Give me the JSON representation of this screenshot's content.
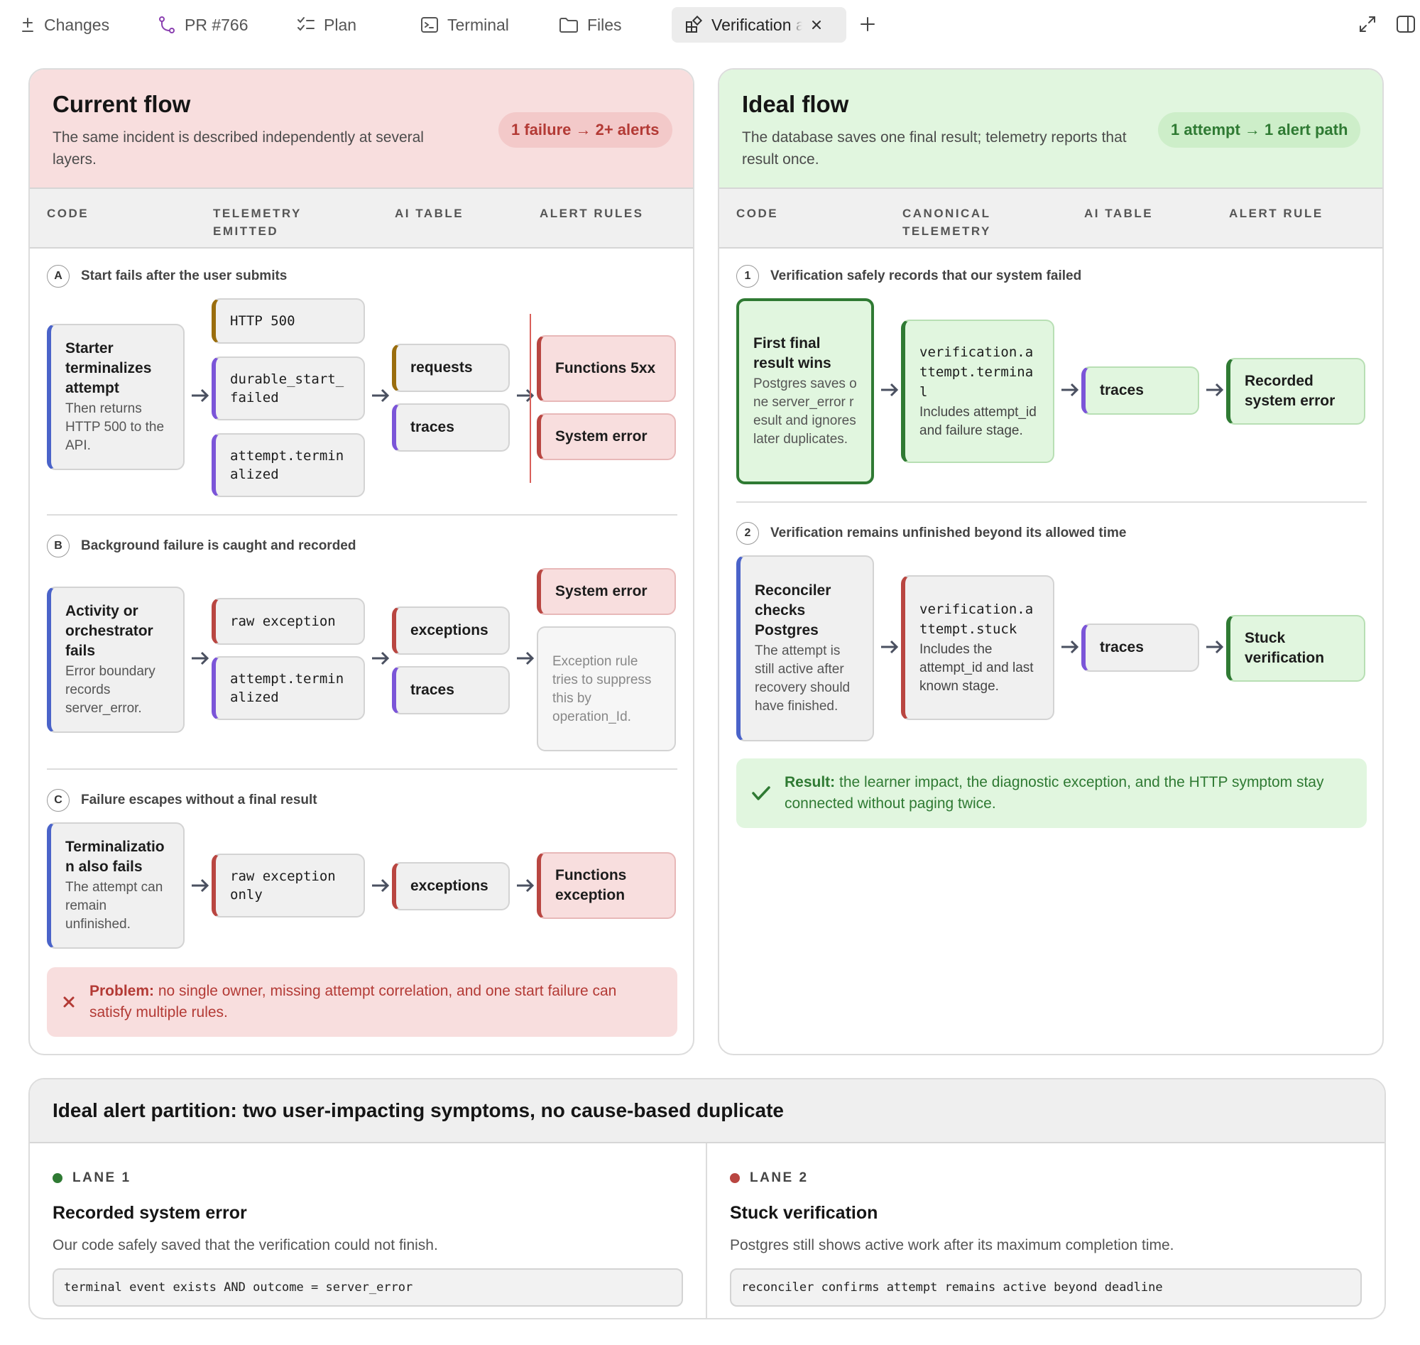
{
  "tabs": {
    "changes": "Changes",
    "pr": "PR #766",
    "plan": "Plan",
    "terminal": "Terminal",
    "files": "Files",
    "active": "Verification al"
  },
  "current": {
    "title": "Current flow",
    "subtitle": "The same incident is described independently at several layers.",
    "badge": "1 failure → 2+ alerts",
    "cols": [
      "CODE",
      "TELEMETRY EMITTED",
      "AI TABLE",
      "ALERT RULES"
    ],
    "a": {
      "letter": "A",
      "heading": "Start fails after the user submits",
      "code_title": "Starter terminalizes attempt",
      "code_sub": "Then returns HTTP 500 to the API.",
      "tel": [
        "HTTP 500",
        "durable_start_failed",
        "attempt.terminalized"
      ],
      "ai": [
        "requests",
        "traces"
      ],
      "alerts": [
        "Functions 5xx",
        "System error"
      ]
    },
    "b": {
      "letter": "B",
      "heading": "Background failure is caught and recorded",
      "code_title": "Activity or orchestrator fails",
      "code_sub": "Error boundary records server_error.",
      "tel": [
        "raw exception",
        "attempt.terminalized"
      ],
      "ai": [
        "exceptions",
        "traces"
      ],
      "alerts": [
        "System error",
        "Exception rule tries to suppress this by operation_Id."
      ]
    },
    "c": {
      "letter": "C",
      "heading": "Failure escapes without a final result",
      "code_title": "Terminalization also fails",
      "code_sub": "The attempt can remain unfinished.",
      "tel": "raw exception only",
      "ai": "exceptions",
      "alert": "Functions exception"
    },
    "problem_label": "Problem:",
    "problem_text": " no single owner, missing attempt correlation, and one start failure can satisfy multiple rules."
  },
  "ideal": {
    "title": "Ideal flow",
    "subtitle": "The database saves one final result; telemetry reports that result once.",
    "badge": "1 attempt → 1 alert path",
    "cols": [
      "CODE",
      "CANONICAL TELEMETRY",
      "AI TABLE",
      "ALERT RULE"
    ],
    "one": {
      "num": "1",
      "heading": "Verification safely records that our system failed",
      "code_title": "First final result wins",
      "code_sub": "Postgres saves one server_error result and ignores later duplicates.",
      "tel_code": "verification.attempt.terminal",
      "tel_sub": "Includes attempt_id and failure stage.",
      "ai": "traces",
      "alert": "Recorded system error"
    },
    "two": {
      "num": "2",
      "heading": "Verification remains unfinished beyond its allowed time",
      "code_title": "Reconciler checks Postgres",
      "code_sub": "The attempt is still active after recovery should have finished.",
      "tel_code": "verification.attempt.stuck",
      "tel_sub": "Includes the attempt_id and last known stage.",
      "ai": "traces",
      "alert": "Stuck verification"
    },
    "result_label": "Result:",
    "result_text": " the learner impact, the diagnostic exception, and the HTTP symptom stay connected without paging twice."
  },
  "partition": {
    "title": "Ideal alert partition: two user-impacting symptoms, no cause-based duplicate",
    "lane1": {
      "label": "LANE 1",
      "title": "Recorded system error",
      "desc": "Our code safely saved that the verification could not finish.",
      "code": "terminal event exists AND outcome = server_error"
    },
    "lane2": {
      "label": "LANE 2",
      "title": "Stuck verification",
      "desc": "Postgres still shows active work after its maximum completion time.",
      "code": "reconciler confirms attempt remains active beyond deadline"
    }
  },
  "colors": {
    "red_bg": "#f8dede",
    "green_bg": "#e1f6df",
    "red_accent": "#b94641",
    "green_accent": "#2f7a33"
  }
}
